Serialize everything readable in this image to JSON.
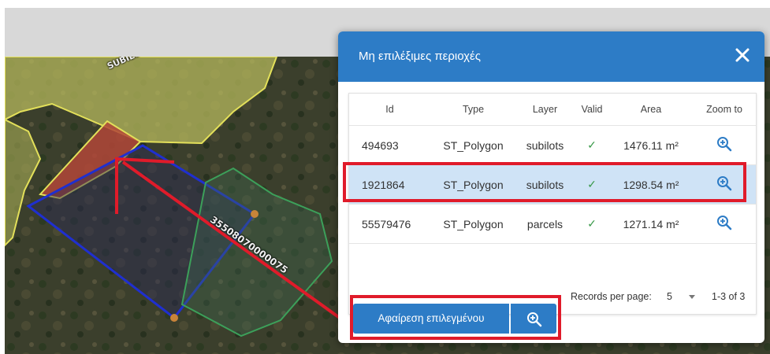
{
  "dialog": {
    "title": "Μη επιλέξιμες περιοχές",
    "close_icon": "close-icon"
  },
  "table": {
    "headers": [
      "Id",
      "Type",
      "Layer",
      "Valid",
      "Area",
      "Zoom to"
    ],
    "rows": [
      {
        "id": "494693",
        "type": "ST_Polygon",
        "layer": "subilots",
        "valid": "✓",
        "area": "1476.11 m²",
        "selected": false
      },
      {
        "id": "1921864",
        "type": "ST_Polygon",
        "layer": "subilots",
        "valid": "✓",
        "area": "1298.54 m²",
        "selected": true
      },
      {
        "id": "55579476",
        "type": "ST_Polygon",
        "layer": "parcels",
        "valid": "✓",
        "area": "1271.14 m²",
        "selected": false
      }
    ]
  },
  "pagination": {
    "label": "Records per page:",
    "per_page": "5",
    "range": "1-3 of 3"
  },
  "actions": {
    "remove_label": "Αφαίρεση επιλεγμένου",
    "zoom_icon": "zoom-in-icon"
  },
  "map": {
    "subilots_label": "SUBILO",
    "parcel_label": "35508070000075"
  },
  "colors": {
    "primary": "#2d7cc6",
    "selected_row": "#cfe3f6",
    "valid_check": "#3a9a4a",
    "annotation": "#e01b2a"
  }
}
